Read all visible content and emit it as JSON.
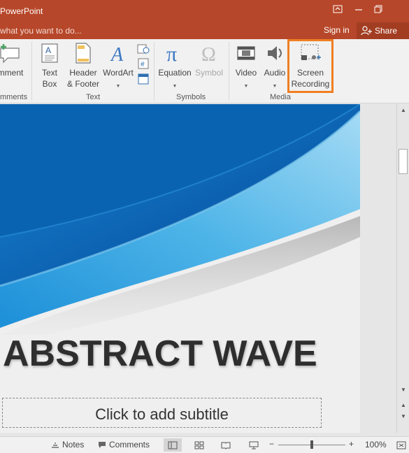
{
  "titlebar": {
    "app_title": "PowerPoint",
    "ribbon_display_icon": "ribbon-display-options-icon",
    "minimize_icon": "minimize-icon",
    "restore_icon": "restore-icon"
  },
  "tellme": {
    "placeholder": "what you want to do...",
    "signin": "Sign in",
    "share": "Share"
  },
  "ribbon": {
    "comment": {
      "label": "mment"
    },
    "textbox": {
      "label1": "Text",
      "label2": "Box"
    },
    "header": {
      "label1": "Header",
      "label2": "& Footer"
    },
    "wordart": {
      "label": "WordArt"
    },
    "equation": {
      "label": "Equation"
    },
    "symbol": {
      "label": "Symbol"
    },
    "video": {
      "label": "Video"
    },
    "audio": {
      "label": "Audio"
    },
    "screen_recording": {
      "label1": "Screen",
      "label2": "Recording"
    },
    "groups": {
      "comments": "mments",
      "text": "Text",
      "symbols": "Symbols",
      "media": "Media"
    }
  },
  "slide": {
    "title": "ABSTRACT WAVE",
    "subtitle_placeholder": "Click to add subtitle"
  },
  "statusbar": {
    "notes": "Notes",
    "comments": "Comments",
    "zoom_out": "−",
    "zoom_in": "+",
    "zoom_level": "100%",
    "zoom_fraction": 0.5
  },
  "colors": {
    "title_bar": "#b7472a",
    "highlight": "#f07f22",
    "wave_dark": "#0a63b1",
    "wave_light": "#4fb5e8"
  }
}
